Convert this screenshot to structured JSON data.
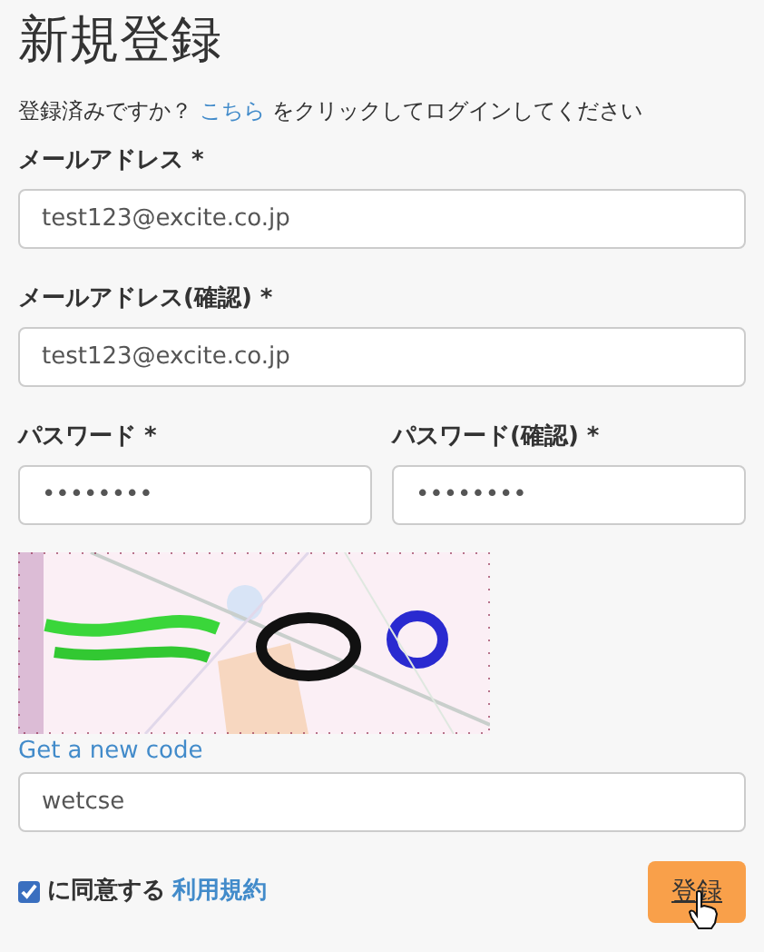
{
  "title": "新規登録",
  "login_prompt": {
    "before": "登録済みですか？",
    "link": "こちら",
    "after": "をクリックしてログインしてください"
  },
  "email": {
    "label": "メールアドレス *",
    "value": "test123@excite.co.jp"
  },
  "email_confirm": {
    "label": "メールアドレス(確認) *",
    "value": "test123@excite.co.jp"
  },
  "password": {
    "label": "パスワード *",
    "value": "••••••••"
  },
  "password_confirm": {
    "label": "パスワード(確認) *",
    "value": "••••••••"
  },
  "captcha": {
    "kind": "picture",
    "new_code_link": "Get a new code",
    "value": "wetcse"
  },
  "terms": {
    "checked": true,
    "label": "に同意する",
    "link": "利用規約"
  },
  "submit_button": "登録"
}
